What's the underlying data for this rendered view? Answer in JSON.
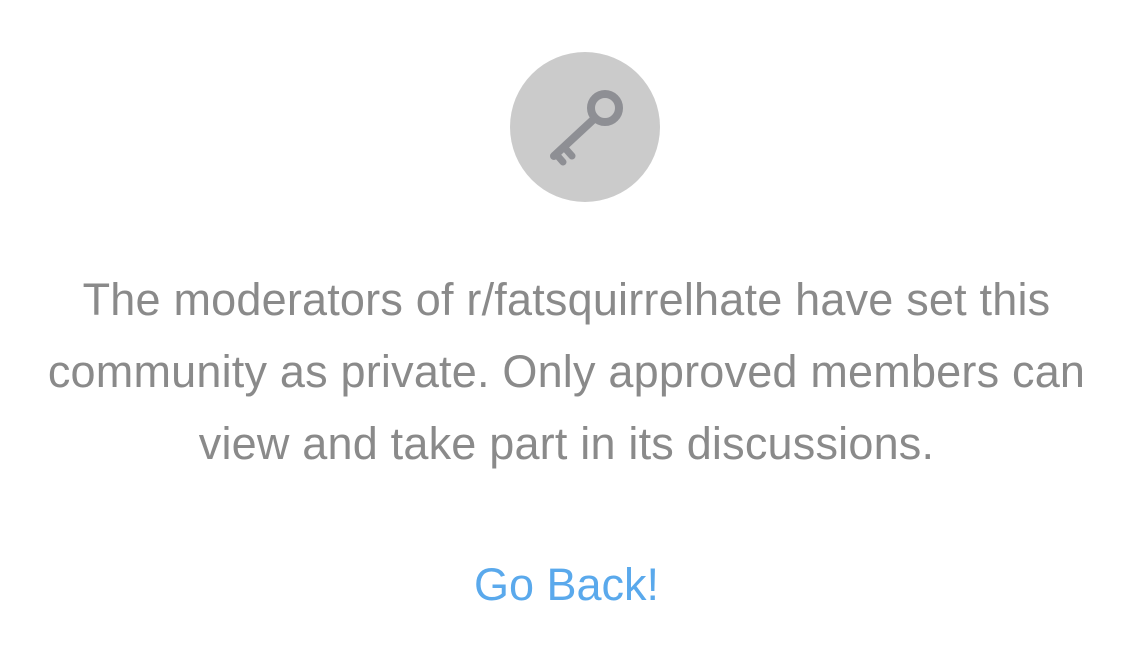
{
  "private_notice": {
    "icon": "key-icon",
    "message_lines": [
      "The moderators of r/fatsquirrelhate have set this",
      "community as private. Only approved members can",
      "view and take part in its discussions."
    ],
    "go_back_label": "Go Back!"
  },
  "colors": {
    "icon_background": "#cbcbcb",
    "icon_foreground": "#8e8f94",
    "message_text": "#8a8a8a",
    "link": "#5aa9ec"
  }
}
